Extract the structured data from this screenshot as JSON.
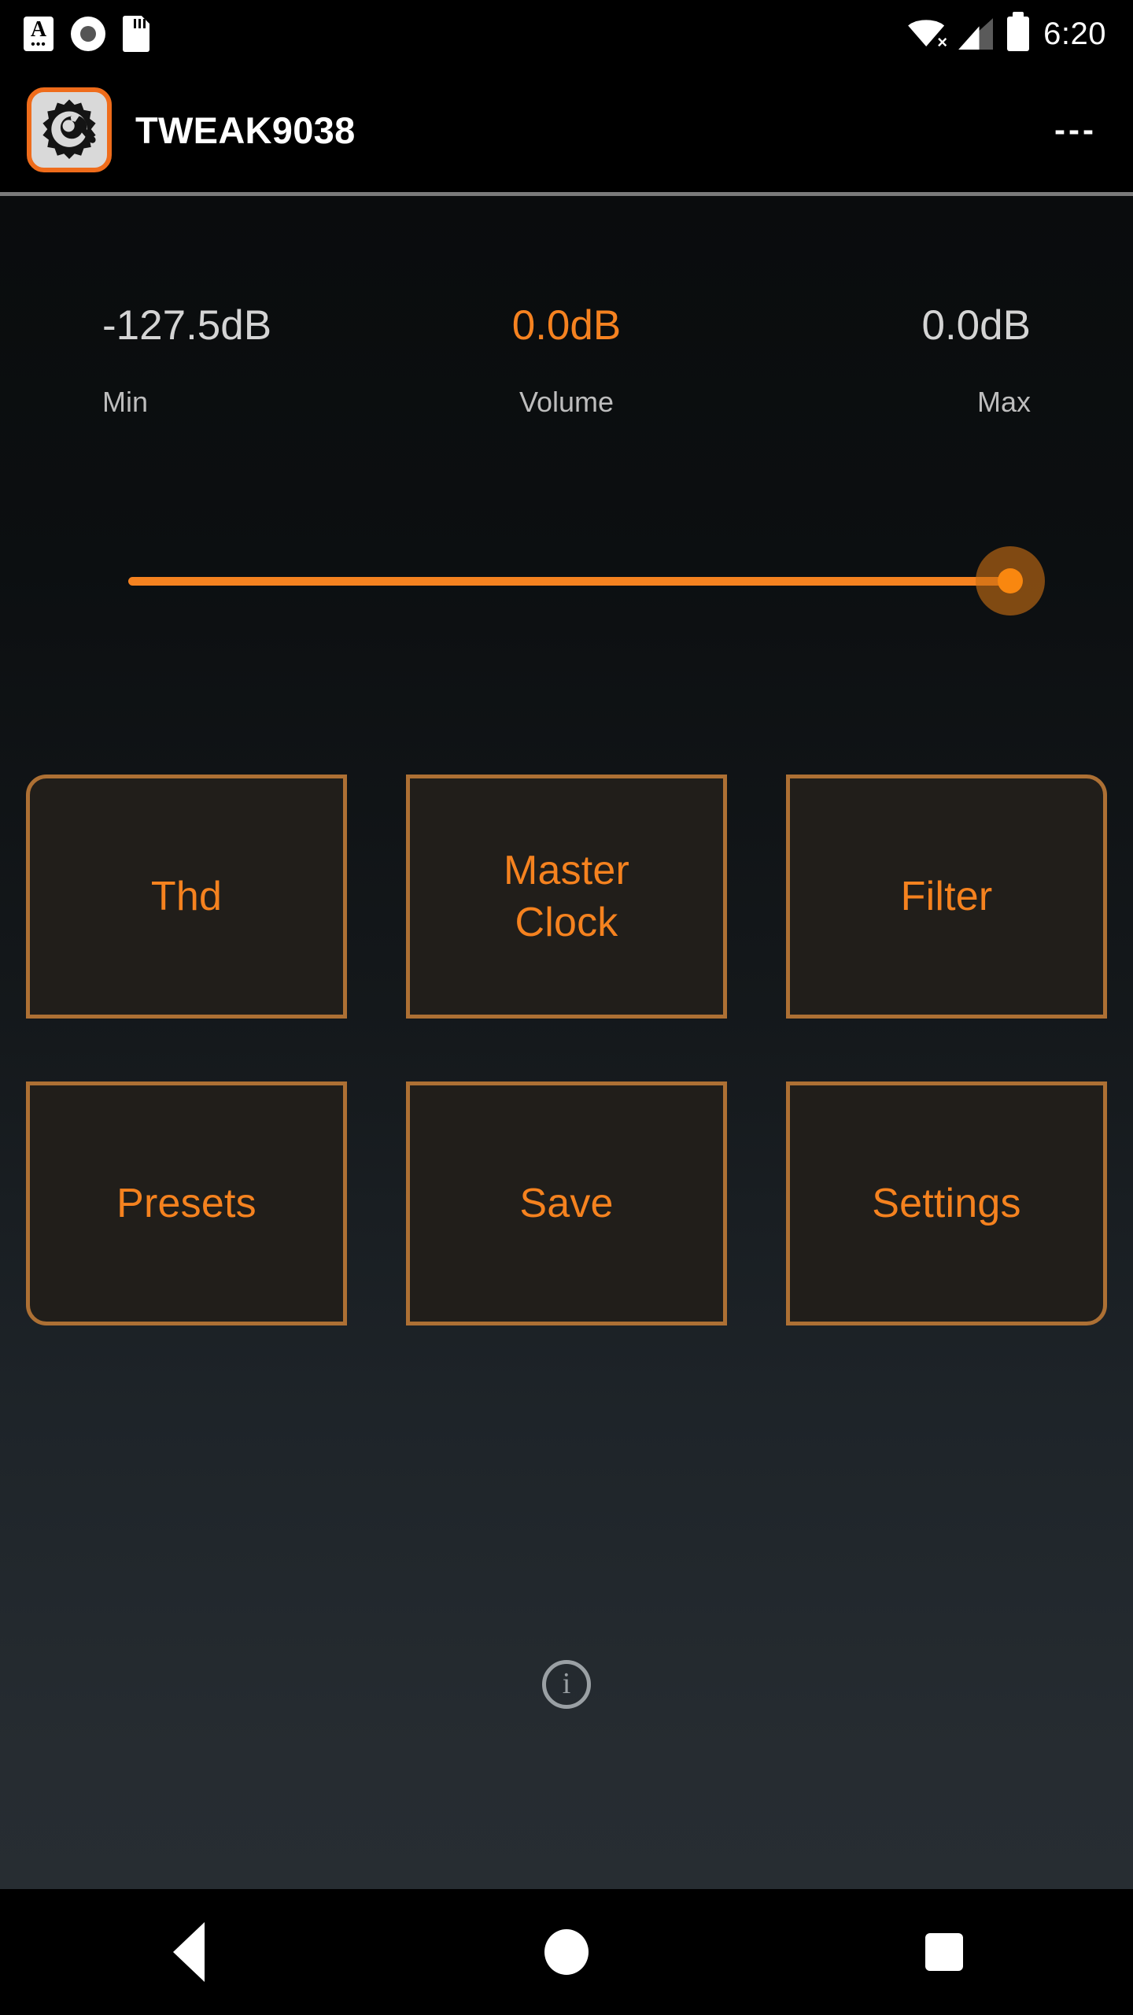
{
  "status_bar": {
    "icons_left": [
      "font-a-icon",
      "camera-dot-icon",
      "sd-card-icon"
    ],
    "font_letter": "A",
    "font_dots": "•••",
    "wifi_state": "wifi-off-icon",
    "wifi_x": "×",
    "signal": "cellular-signal-icon",
    "battery": "battery-full-icon",
    "time": "6:20"
  },
  "title_bar": {
    "app_icon": "gear-wrench-icon",
    "title": "TWEAK9038",
    "overflow": "---"
  },
  "volume": {
    "min_value": "-127.5dB",
    "current_value": "0.0dB",
    "max_value": "0.0dB",
    "min_label": "Min",
    "current_label": "Volume",
    "max_label": "Max",
    "slider_percent": 100,
    "accent_color": "#f58220"
  },
  "buttons": [
    {
      "label": "Thd",
      "lines": [
        "Thd"
      ]
    },
    {
      "label": "Master Clock",
      "lines": [
        "Master",
        "Clock"
      ]
    },
    {
      "label": "Filter",
      "lines": [
        "Filter"
      ]
    },
    {
      "label": "Presets",
      "lines": [
        "Presets"
      ]
    },
    {
      "label": "Save",
      "lines": [
        "Save"
      ]
    },
    {
      "label": "Settings",
      "lines": [
        "Settings"
      ]
    }
  ],
  "footer": {
    "info_icon": "info-circle-icon",
    "info_glyph": "i"
  },
  "nav_bar": {
    "back": "back-triangle-icon",
    "home": "home-circle-icon",
    "recents": "recents-square-icon"
  },
  "colors": {
    "accent_orange": "#f58220",
    "button_border": "#ad7034",
    "button_fill": "#211e1a",
    "text_gray": "#d4d4d4",
    "label_gray": "#bdbdbd"
  }
}
